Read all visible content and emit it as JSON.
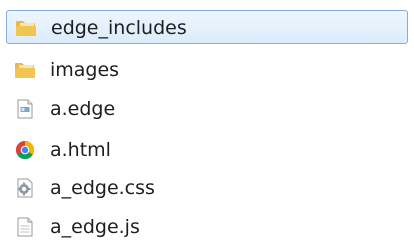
{
  "files": [
    {
      "name": "edge_includes",
      "icon": "folder-icon",
      "selected": true
    },
    {
      "name": "images",
      "icon": "folder-icon",
      "selected": false
    },
    {
      "name": "a.edge",
      "icon": "edge-file-icon",
      "selected": false
    },
    {
      "name": "a.html",
      "icon": "chrome-icon",
      "selected": false
    },
    {
      "name": "a_edge.css",
      "icon": "css-gear-file-icon",
      "selected": false
    },
    {
      "name": "a_edge.js",
      "icon": "text-file-icon",
      "selected": false
    }
  ],
  "colors": {
    "selection_border": "#84acdd",
    "selection_background": "#dcecfc",
    "folder": "#e8b84a",
    "text": "#1e1e1e"
  }
}
